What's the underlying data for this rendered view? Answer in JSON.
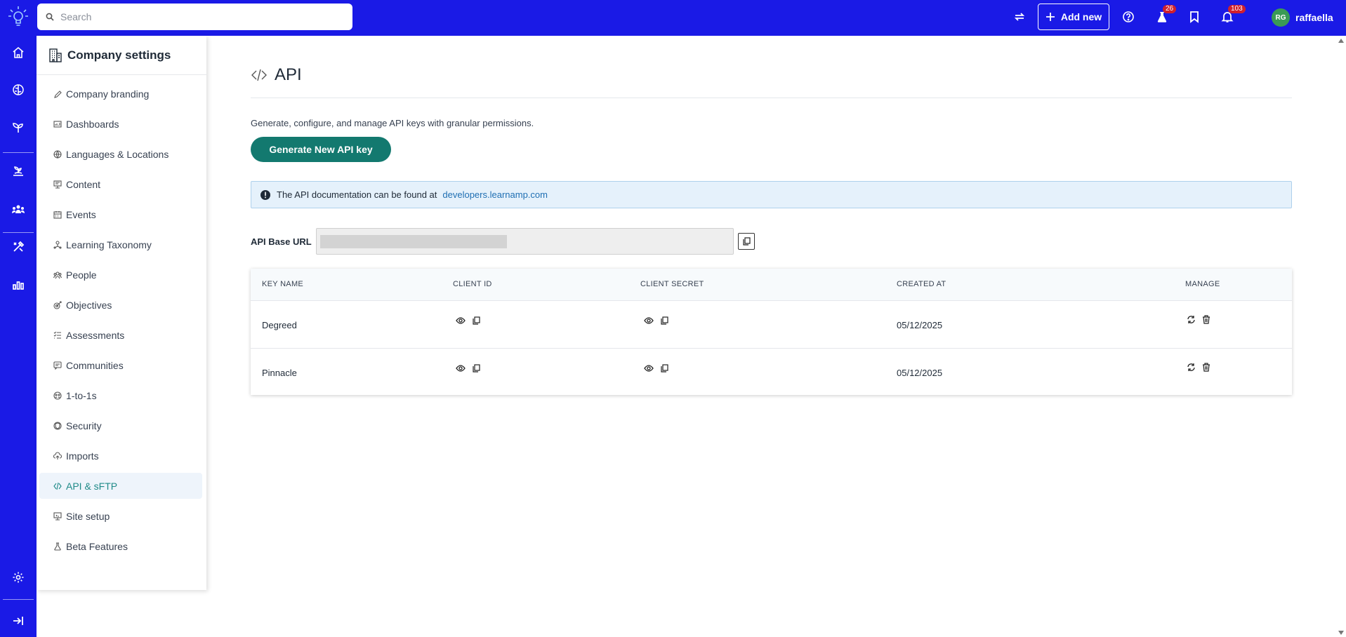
{
  "topbar": {
    "search_placeholder": "Search",
    "add_new_label": "Add new",
    "flask_badge": "26",
    "notif_badge": "103",
    "user_initials": "RG",
    "user_name": "raffaella"
  },
  "panel": {
    "title": "Company settings",
    "items": [
      {
        "label": "Company branding",
        "icon": "brush-icon"
      },
      {
        "label": "Dashboards",
        "icon": "dashboard-icon"
      },
      {
        "label": "Languages & Locations",
        "icon": "globe-icon"
      },
      {
        "label": "Content",
        "icon": "content-icon"
      },
      {
        "label": "Events",
        "icon": "calendar-icon"
      },
      {
        "label": "Learning Taxonomy",
        "icon": "taxonomy-icon"
      },
      {
        "label": "People",
        "icon": "people-icon"
      },
      {
        "label": "Objectives",
        "icon": "objectives-icon"
      },
      {
        "label": "Assessments",
        "icon": "assessments-icon"
      },
      {
        "label": "Communities",
        "icon": "chat-icon"
      },
      {
        "label": "1-to-1s",
        "icon": "one-to-one-icon"
      },
      {
        "label": "Security",
        "icon": "shield-icon"
      },
      {
        "label": "Imports",
        "icon": "cloud-upload-icon"
      },
      {
        "label": "API & sFTP",
        "icon": "code-icon"
      },
      {
        "label": "Site setup",
        "icon": "monitor-icon"
      },
      {
        "label": "Beta Features",
        "icon": "flask-icon"
      }
    ],
    "active_index": 13
  },
  "main": {
    "title": "API",
    "description": "Generate, configure, and manage API keys with granular permissions.",
    "generate_button": "Generate New API key",
    "info_text": "The API documentation can be found at",
    "info_link": "developers.learnamp.com",
    "base_url_label": "API Base URL",
    "table": {
      "headers": [
        "KEY NAME",
        "CLIENT ID",
        "CLIENT SECRET",
        "CREATED AT",
        "MANAGE"
      ],
      "rows": [
        {
          "key_name": "Degreed",
          "created_at": "05/12/2025"
        },
        {
          "key_name": "Pinnacle",
          "created_at": "05/12/2025"
        }
      ]
    }
  },
  "colors": {
    "brand_blue": "#1a1ae6",
    "teal": "#13796f",
    "info_bg": "#e5f1fb",
    "badge_red": "#d0202e"
  }
}
